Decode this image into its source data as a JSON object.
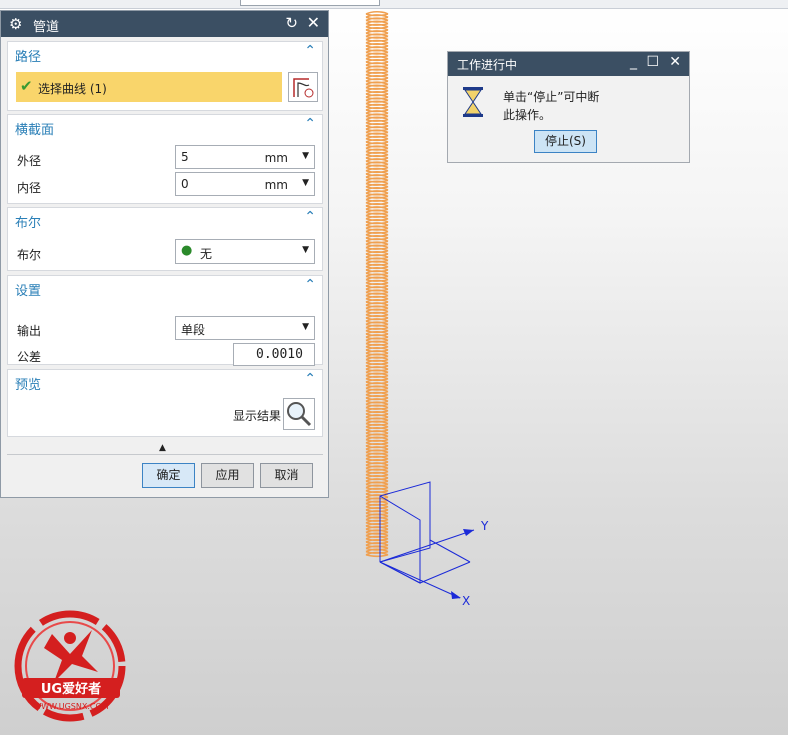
{
  "dialog": {
    "title": "管道",
    "path_section": {
      "title": "路径",
      "selection_label": "选择曲线 (1)"
    },
    "cross_section": {
      "title": "横截面",
      "outer_label": "外径",
      "outer_value": "5",
      "outer_unit": "mm",
      "inner_label": "内径",
      "inner_value": "0",
      "inner_unit": "mm"
    },
    "boolean_section": {
      "title": "布尔",
      "boolean_label": "布尔",
      "boolean_value": "无"
    },
    "settings_section": {
      "title": "设置",
      "output_label": "输出",
      "output_value": "单段",
      "tolerance_label": "公差",
      "tolerance_value": "0.0010"
    },
    "preview_section": {
      "title": "预览",
      "show_result_label": "显示结果"
    },
    "buttons": {
      "ok": "确定",
      "apply": "应用",
      "cancel": "取消"
    }
  },
  "progress_popup": {
    "title": "工作进行中",
    "message_line1": "单击“停止”可中断",
    "message_line2": "此操作。",
    "stop_button": "停止(S)"
  },
  "viewport": {
    "axis_y_label": "Y",
    "axis_x_label": "X",
    "helix_color": "#f0a050",
    "csys_color": "#1b2ad8"
  },
  "watermark": {
    "brand": "UG爱好者",
    "site": "WWW.UGSNX.COM"
  },
  "icons": [
    "gear-icon",
    "reset-icon",
    "close-icon",
    "check-icon",
    "curve-select-icon",
    "boolean-icon",
    "magnifier-icon",
    "hourglass-icon"
  ]
}
